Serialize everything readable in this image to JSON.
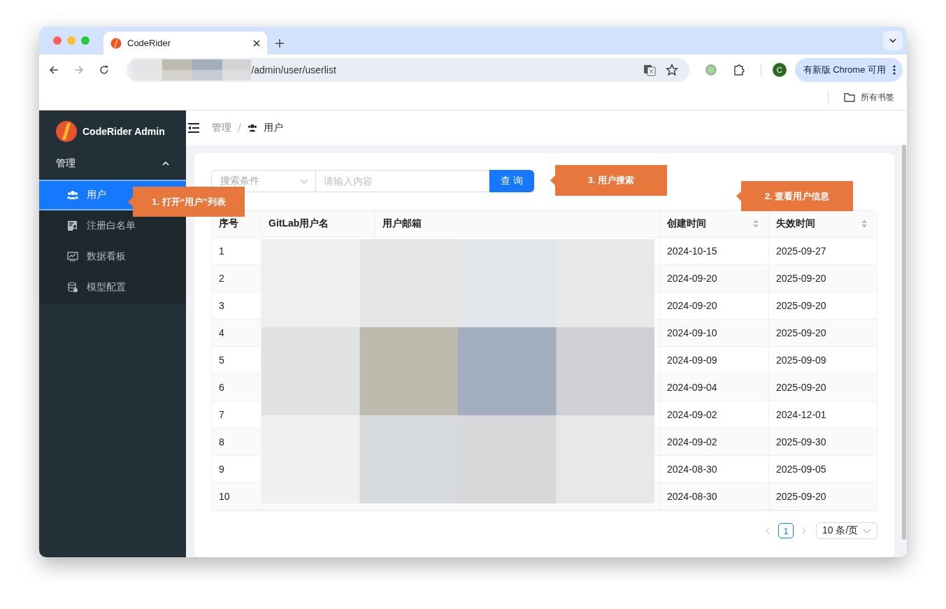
{
  "browser": {
    "tab_title": "CodeRider",
    "url": "/admin/user/userlist",
    "profile_initial": "C",
    "update_button": "有新版 Chrome 可用",
    "bookmarks": "所有书签"
  },
  "sidebar": {
    "brand": "CodeRider Admin",
    "group": {
      "label": "管理",
      "expanded": true
    },
    "items": [
      {
        "label": "用户",
        "selected": true
      },
      {
        "label": "注册白名单",
        "selected": false
      },
      {
        "label": "数据看板",
        "selected": false
      },
      {
        "label": "模型配置",
        "selected": false
      }
    ]
  },
  "breadcrumb": [
    "管理",
    "用户"
  ],
  "search": {
    "select_placeholder": "搜索条件",
    "input_placeholder": "请输入内容",
    "button": "查 询"
  },
  "table": {
    "columns": [
      {
        "label": "序号",
        "sortable": false
      },
      {
        "label": "GitLab用户名",
        "sortable": false
      },
      {
        "label": "用户邮箱",
        "sortable": false
      },
      {
        "label": "创建时间",
        "sortable": true
      },
      {
        "label": "失效时间",
        "sortable": true
      }
    ],
    "rows": [
      {
        "no": "1",
        "created": "2024-10-15",
        "expires": "2025-09-27"
      },
      {
        "no": "2",
        "created": "2024-09-20",
        "expires": "2025-09-20"
      },
      {
        "no": "3",
        "created": "2024-09-20",
        "expires": "2025-09-20"
      },
      {
        "no": "4",
        "created": "2024-09-10",
        "expires": "2025-09-20"
      },
      {
        "no": "5",
        "created": "2024-09-09",
        "expires": "2025-09-09"
      },
      {
        "no": "6",
        "created": "2024-09-04",
        "expires": "2025-09-20"
      },
      {
        "no": "7",
        "created": "2024-09-02",
        "expires": "2024-12-01"
      },
      {
        "no": "8",
        "created": "2024-09-02",
        "expires": "2025-09-30"
      },
      {
        "no": "9",
        "created": "2024-08-30",
        "expires": "2025-09-05"
      },
      {
        "no": "10",
        "created": "2024-08-30",
        "expires": "2025-09-20"
      }
    ]
  },
  "pagination": {
    "page": "1",
    "page_size": "10 条/页"
  },
  "callouts": [
    "1. 打开“用户”列表",
    "2. 查看用户信息",
    "3. 用户搜索"
  ]
}
